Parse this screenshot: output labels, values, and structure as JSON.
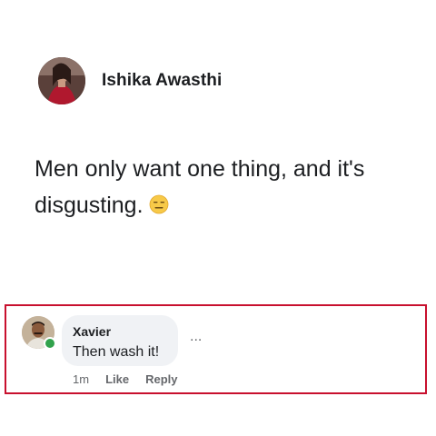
{
  "post": {
    "author_name": "Ishika Awasthi",
    "author_avatar_icon": "profile-photo-icon",
    "text": "Men only want one thing, and it's disgusting.",
    "emoji_icon": "expressionless-face-emoji-icon"
  },
  "comment": {
    "commenter_name": "Xavier",
    "commenter_avatar_icon": "profile-photo-icon",
    "online_status_color": "#31a24c",
    "text": "Then wash it!",
    "more_label": "...",
    "time": "1m",
    "like_label": "Like",
    "reply_label": "Reply"
  },
  "colors": {
    "highlight_border": "#c8102e",
    "bubble_background": "#f0f2f5",
    "secondary_text": "#65676b"
  }
}
